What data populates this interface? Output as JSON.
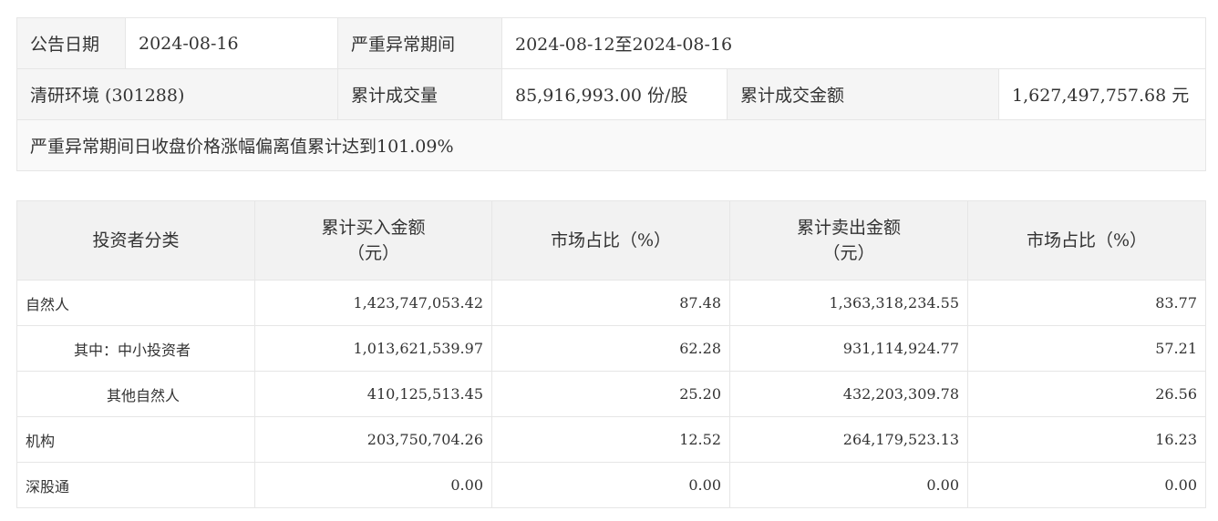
{
  "announcement": {
    "date_label": "公告日期",
    "date_value": "2024-08-16",
    "period_label": "严重异常期间",
    "period_value": "2024-08-12至2024-08-16",
    "stock_name": "清研环境 (301288)",
    "volume_label": "累计成交量",
    "volume_value": "85,916,993.00 份/股",
    "amount_label": "累计成交金额",
    "amount_value": "1,627,497,757.68 元",
    "note": "严重异常期间日收盘价格涨幅偏离值累计达到101.09%"
  },
  "trade_table": {
    "headers": {
      "category": "投资者分类",
      "buy_amount": "累计买入金额",
      "buy_unit": "（元）",
      "buy_share": "市场占比（%）",
      "sell_amount": "累计卖出金额",
      "sell_unit": "（元）",
      "sell_share": "市场占比（%）"
    },
    "rows": [
      {
        "category": "自然人",
        "buy": "1,423,747,053.42",
        "buy_pct": "87.48",
        "sell": "1,363,318,234.55",
        "sell_pct": "83.77"
      },
      {
        "category": "其中：中小投资者",
        "buy": "1,013,621,539.97",
        "buy_pct": "62.28",
        "sell": "931,114,924.77",
        "sell_pct": "57.21"
      },
      {
        "category": "其他自然人",
        "buy": "410,125,513.45",
        "buy_pct": "25.20",
        "sell": "432,203,309.78",
        "sell_pct": "26.56"
      },
      {
        "category": "机构",
        "buy": "203,750,704.26",
        "buy_pct": "12.52",
        "sell": "264,179,523.13",
        "sell_pct": "16.23"
      },
      {
        "category": "深股通",
        "buy": "0.00",
        "buy_pct": "0.00",
        "sell": "0.00",
        "sell_pct": "0.00"
      }
    ]
  }
}
